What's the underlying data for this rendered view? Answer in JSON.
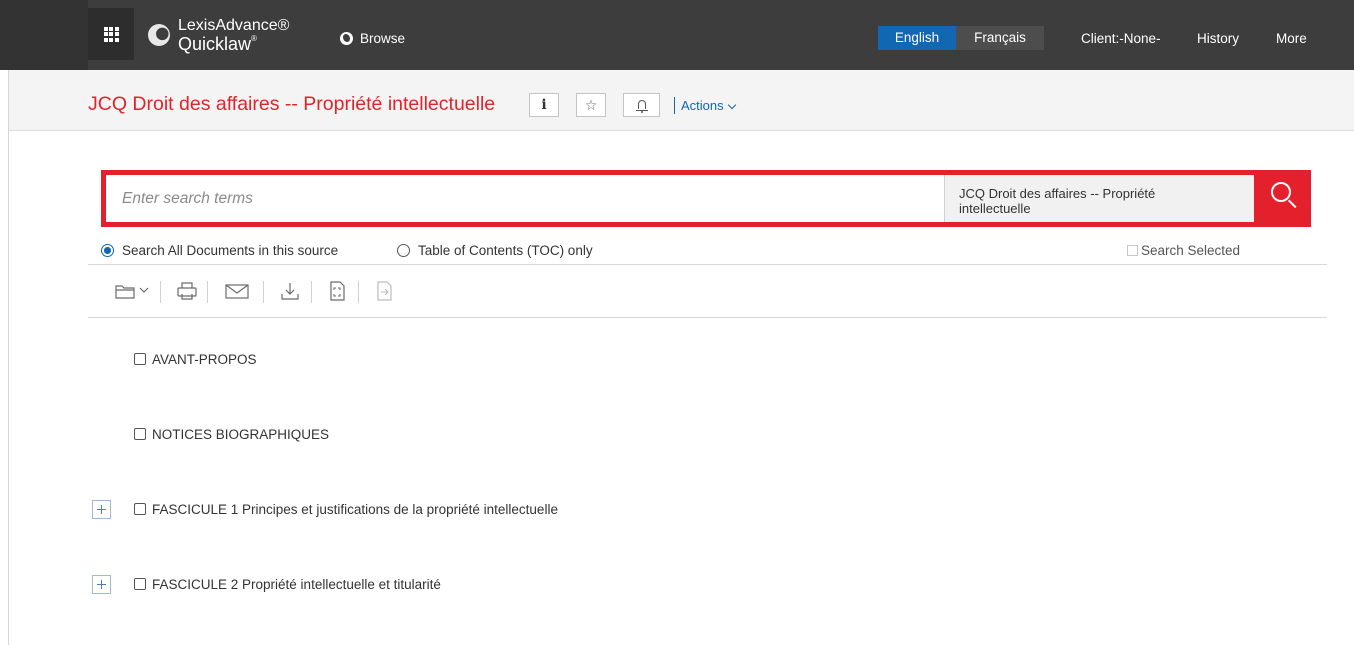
{
  "header": {
    "brand_line1": "LexisAdvance®",
    "brand_line2": "Quicklaw",
    "brand_mark": "®",
    "browse_label": "Browse",
    "lang_english": "English",
    "lang_french": "Français",
    "client_label": "Client:-None-",
    "history_label": "History",
    "more_label": "More"
  },
  "titlebar": {
    "title": "JCQ Droit des affaires -- Propriété intellectuelle",
    "info_label": "i",
    "star_glyph": "☆",
    "actions_label": "Actions"
  },
  "search": {
    "placeholder": "Enter search terms",
    "value": "",
    "scope_line1": "JCQ Droit des affaires -- Propriété",
    "scope_line2": "intellectuelle"
  },
  "options": {
    "radio_all": "Search All Documents in this source",
    "radio_toc": "Table of Contents (TOC) only",
    "selected_radio": "all",
    "search_selected_label": "Search Selected"
  },
  "toolbar": {
    "icons": [
      "folder-icon",
      "chevron-down-icon",
      "print-icon",
      "email-icon",
      "download-icon",
      "expand-icon",
      "send-icon"
    ]
  },
  "toc": {
    "items": [
      {
        "label": "AVANT-PROPOS",
        "expandable": false
      },
      {
        "label": "NOTICES BIOGRAPHIQUES",
        "expandable": false
      },
      {
        "label": "FASCICULE 1 Principes et justifications de la propriété intellectuelle",
        "expandable": true
      },
      {
        "label": "FASCICULE 2 Propriété intellectuelle et titularité",
        "expandable": true
      }
    ]
  },
  "colors": {
    "accent_red": "#e4202c",
    "accent_blue": "#1167b1",
    "topbar_bg": "#3d3d3d"
  }
}
